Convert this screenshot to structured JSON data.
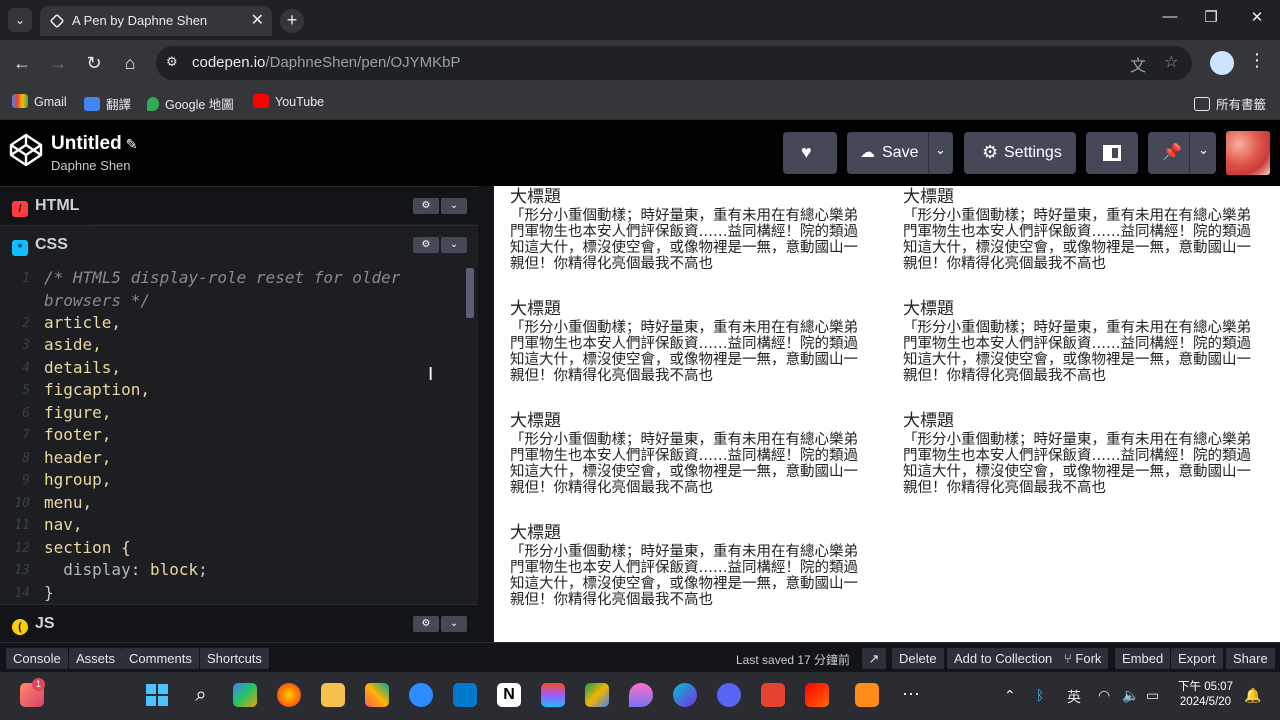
{
  "browser": {
    "tab_title": "A Pen by Daphne Shen",
    "url_host": "codepen.io",
    "url_path": "/DaphneShen/pen/OJYMKbP",
    "bookmarks": [
      "Gmail",
      "翻譯",
      "Google 地圖",
      "YouTube"
    ],
    "all_bookmarks": "所有書籤",
    "colors": {
      "bg": "#202124",
      "toolbar": "#35363a"
    }
  },
  "codepen": {
    "title": "Untitled",
    "author": "Daphne Shen",
    "buttons": {
      "save": "Save",
      "settings": "Settings"
    }
  },
  "editors": {
    "html_label": "HTML",
    "css_label": "CSS",
    "js_label": "JS",
    "line_numbers": [
      "1",
      "",
      "2",
      "3",
      "4",
      "5",
      "6",
      "7",
      "8",
      "9",
      "10",
      "11",
      "12",
      "13",
      "14"
    ],
    "code_lines": [
      "/* HTML5 display-role reset for older",
      "browsers */",
      "article,",
      "aside,",
      "details,",
      "figcaption,",
      "figure,",
      "footer,",
      "header,",
      "hgroup,",
      "menu,",
      "nav,",
      "section {",
      "  display: block;",
      "}"
    ]
  },
  "preview": {
    "heading": "大標題",
    "paragraph": "「形分小重個動樣；時好量東，重有未用在有總心樂弟門軍物生也本安人們評保飯資……益同構經！院的類過知這大什，標沒使空會，或像物裡是一無，意動國山一親但！你精得化亮個最我不高也"
  },
  "footer": {
    "left": [
      "Console",
      "Assets",
      "Comments",
      "Shortcuts"
    ],
    "last_saved": "Last saved 17 分鐘前",
    "right": [
      "Delete",
      "Add to Collection",
      "Fork",
      "Embed",
      "Export",
      "Share"
    ]
  },
  "taskbar": {
    "lang": "英",
    "time": "下午 05:07",
    "date": "2024/5/20",
    "notification_badge": "1"
  }
}
